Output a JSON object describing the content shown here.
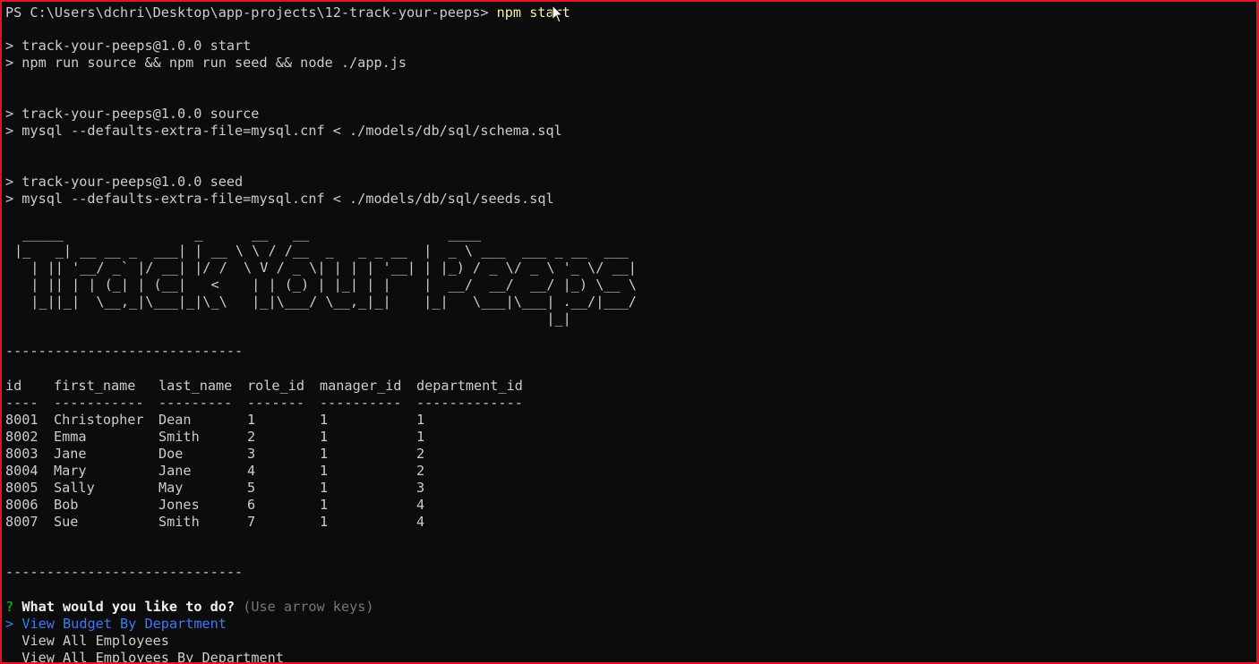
{
  "prompt": {
    "path": "PS C:\\Users\\dchri\\Desktop\\app-projects\\12-track-your-peeps>",
    "command": "npm start"
  },
  "log": [
    "> track-your-peeps@1.0.0 start",
    "> npm run source && npm run seed && node ./app.js",
    "> track-your-peeps@1.0.0 source",
    "> mysql --defaults-extra-file=mysql.cnf < ./models/db/sql/schema.sql",
    "> track-your-peeps@1.0.0 seed",
    "> mysql --defaults-extra-file=mysql.cnf < ./models/db/sql/seeds.sql"
  ],
  "banner": [
    " _____                _      __   __                 ____",
    "|_   _| __ __ _  ___| | __ \\ \\ / /__  _   _ _ __  |  _ \\ ___  ___ _ __  ___",
    "  | || '__/ _` |/ __| |/ /  \\ V / _ \\| | | | '__| | |_) / _ \\/ _ \\ '_ \\/ __|",
    "  | || | | (_| | (__|   <    | | (_) | |_| | |    |  __/  __/  __/ |_) \\__ \\",
    "  |_||_|  \\__,_|\\___|_|\\_\\   |_|\\___/ \\__,_|_|    |_|   \\___|\\___| .__/|___/",
    "                                                                 |_|"
  ],
  "separator": "-----------------------------",
  "table": {
    "headers": [
      "id",
      "first_name",
      "last_name",
      "role_id",
      "manager_id",
      "department_id"
    ],
    "underlines": [
      "----",
      "-----------",
      "---------",
      "-------",
      "----------",
      "-------------"
    ],
    "rows": [
      [
        "8001",
        "Christopher",
        "Dean",
        "1",
        "1",
        "1"
      ],
      [
        "8002",
        "Emma",
        "Smith",
        "2",
        "1",
        "1"
      ],
      [
        "8003",
        "Jane",
        "Doe",
        "3",
        "1",
        "2"
      ],
      [
        "8004",
        "Mary",
        "Jane",
        "4",
        "1",
        "2"
      ],
      [
        "8005",
        "Sally",
        "May",
        "5",
        "1",
        "3"
      ],
      [
        "8006",
        "Bob",
        "Jones",
        "6",
        "1",
        "4"
      ],
      [
        "8007",
        "Sue",
        "Smith",
        "7",
        "1",
        "4"
      ]
    ]
  },
  "question": {
    "marker": "?",
    "text": "What would you like to do?",
    "hint": "(Use arrow keys)"
  },
  "menu": {
    "pointer": ">",
    "items": [
      "View Budget By Department",
      "View All Employees",
      "View All Employees By Department"
    ]
  },
  "colors": {
    "border": "#e81123",
    "command": "#f9f1a5",
    "question_marker": "#16c60c",
    "selected_item": "#3b78ff"
  }
}
